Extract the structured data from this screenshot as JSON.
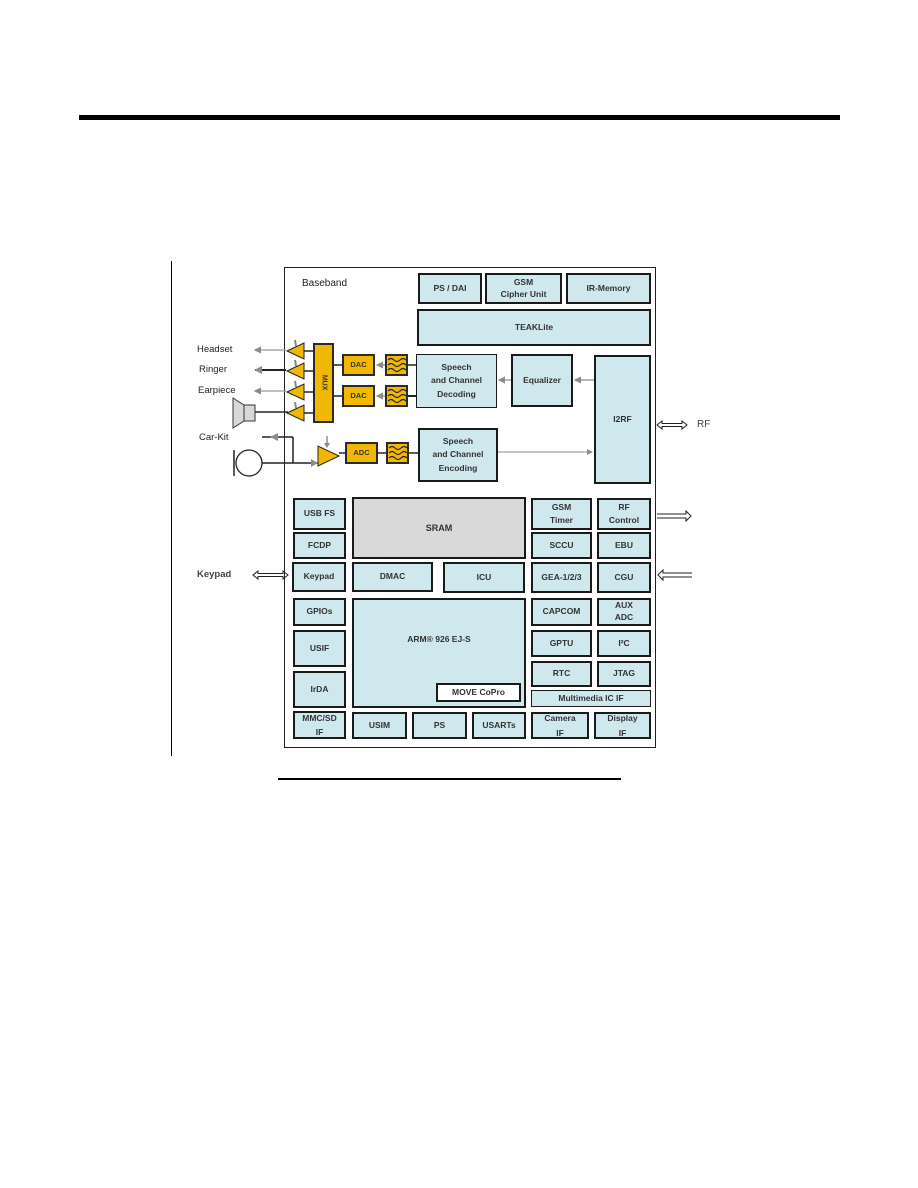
{
  "diagram": {
    "frame_label": "Baseband",
    "external_labels": {
      "headset": "Headset",
      "ringer": "Ringer",
      "earpiece": "Earpiece",
      "car_kit": "Car-Kit",
      "keypad": "Keypad",
      "rf": "RF"
    },
    "audio": {
      "mux": "MUX",
      "dac1": "DAC",
      "dac2": "DAC",
      "adc": "ADC"
    },
    "blocks": {
      "ps_dai": "PS / DAI",
      "gsm_cipher": "GSM\nCipher Unit",
      "ir_memory": "IR-Memory",
      "teaklite": "TEAKLite",
      "speech_decoding": "Speech\nand Channel\nDecoding",
      "equalizer": "Equalizer",
      "i2rf": "I2RF",
      "speech_encoding": "Speech\nand Channel\nEncoding",
      "usb_fs": "USB FS",
      "fcdp": "FCDP",
      "keypad": "Keypad",
      "gpios": "GPIOs",
      "usif": "USIF",
      "irda": "IrDA",
      "mmc_sd": "MMC/SD\nIF",
      "sram": "SRAM",
      "dmac": "DMAC",
      "icu": "ICU",
      "arm": "ARM® 926 EJ-S",
      "move_copro": "MOVE CoPro",
      "usim": "USIM",
      "ps": "PS",
      "usarts": "USARTs",
      "gsm_timer": "GSM\nTimer",
      "rf_control": "RF\nControl",
      "sccu": "SCCU",
      "ebu": "EBU",
      "gea": "GEA-1/2/3",
      "cgu": "CGU",
      "capcom": "CAPCOM",
      "aux_adc": "AUX\nADC",
      "gptu": "GPTU",
      "i2c": "I²C",
      "rtc": "RTC",
      "jtag": "JTAG",
      "multimedia_ic_if": "Multimedia IC IF",
      "camera_if": "Camera\nIF",
      "display_if": "Display\nIF"
    },
    "colors": {
      "block_fill": "#cfe8ee",
      "memory_fill": "#d9d9d9",
      "audio_fill": "#f0b800",
      "arrow_gray": "#8c8c8c"
    }
  }
}
